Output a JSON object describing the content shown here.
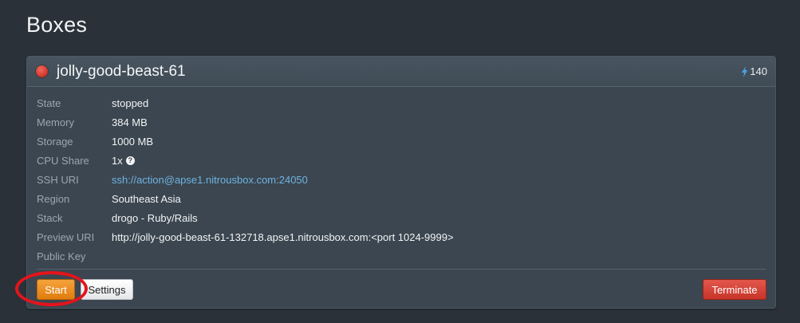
{
  "page": {
    "title": "Boxes"
  },
  "box": {
    "name": "jolly-good-beast-61",
    "status_color": "#d93a2e",
    "credits_icon": "bolt-icon",
    "credits": "140",
    "details": [
      {
        "label": "State",
        "value": "stopped"
      },
      {
        "label": "Memory",
        "value": "384 MB"
      },
      {
        "label": "Storage",
        "value": "1000 MB"
      },
      {
        "label": "CPU Share",
        "value": "1x"
      },
      {
        "label": "SSH URI",
        "value": "ssh://action@apse1.nitrousbox.com:24050"
      },
      {
        "label": "Region",
        "value": "Southeast Asia"
      },
      {
        "label": "Stack",
        "value": "drogo - Ruby/Rails"
      },
      {
        "label": "Preview URI",
        "value": "http://jolly-good-beast-61-132718.apse1.nitrousbox.com:<port 1024-9999>"
      },
      {
        "label": "Public Key",
        "value": ""
      }
    ]
  },
  "actions": {
    "start_label": "Start",
    "settings_label": "Settings",
    "terminate_label": "Terminate"
  },
  "colors": {
    "start": "#ee8f1f",
    "terminate": "#d4443a",
    "link": "#6fb3e0",
    "highlight": "#e4141c"
  }
}
